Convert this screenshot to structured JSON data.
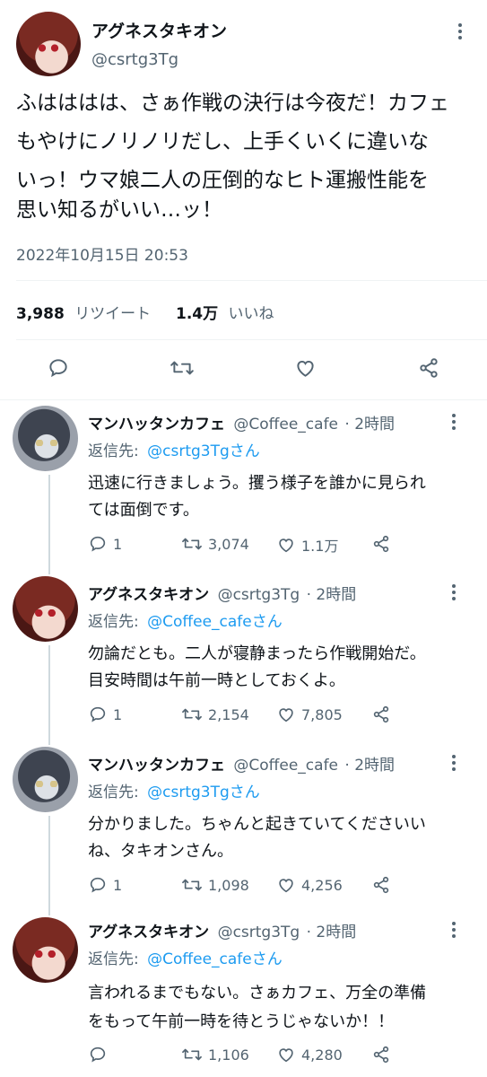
{
  "main_tweet": {
    "display_name": "アグネスタキオン",
    "handle": "@csrtg3Tg",
    "text_lines": [
      "ふはははは、さぁ作戦の決行は今夜だ！カフェ",
      "もやけにノリノリだし、上手くいくに違いな",
      "いっ！ウマ娘二人の圧倒的なヒト運搬性能を",
      "思い知るがいい…ッ！"
    ],
    "timestamp": "2022年10月15日 20:53",
    "retweets": "3,988",
    "retweets_label": "リツイート",
    "likes": "1.4万",
    "likes_label": "いいね"
  },
  "replies": [
    {
      "display_name": "マンハッタンカフェ",
      "handle": "@Coffee_cafe",
      "time": "· 2時間",
      "reply_label": "返信先:",
      "reply_to": "@csrtg3Tgさん",
      "text_lines": [
        "迅速に行きましょう。攫う様子を誰かに見られ",
        "ては面倒です。"
      ],
      "replies": "1",
      "retweets": "3,074",
      "likes": "1.1万"
    },
    {
      "display_name": "アグネスタキオン",
      "handle": "@csrtg3Tg",
      "time": "· 2時間",
      "reply_label": "返信先:",
      "reply_to": "@Coffee_cafeさん",
      "text_lines": [
        "勿論だとも。二人が寝静まったら作戦開始だ。",
        "目安時間は午前一時としておくよ。"
      ],
      "replies": "1",
      "retweets": "2,154",
      "likes": "7,805"
    },
    {
      "display_name": "マンハッタンカフェ",
      "handle": "@Coffee_cafe",
      "time": "· 2時間",
      "reply_label": "返信先:",
      "reply_to": "@csrtg3Tgさん",
      "text_lines": [
        "分かりました。ちゃんと起きていてくださいい",
        "ね、タキオンさん。"
      ],
      "replies": "1",
      "retweets": "1,098",
      "likes": "4,256"
    },
    {
      "display_name": "アグネスタキオン",
      "handle": "@csrtg3Tg",
      "time": "· 2時間",
      "reply_label": "返信先:",
      "reply_to": "@Coffee_cafeさん",
      "text_lines": [
        "言われるまでもない。さぁカフェ、万全の準備",
        "をもって午前一時を待とうじゃないか！！"
      ],
      "replies": "",
      "retweets": "1,106",
      "likes": "4,280"
    }
  ],
  "colors": {
    "text": "#0f1419",
    "muted": "#536471",
    "link": "#1d9bf0",
    "divider": "#eff3f4"
  }
}
